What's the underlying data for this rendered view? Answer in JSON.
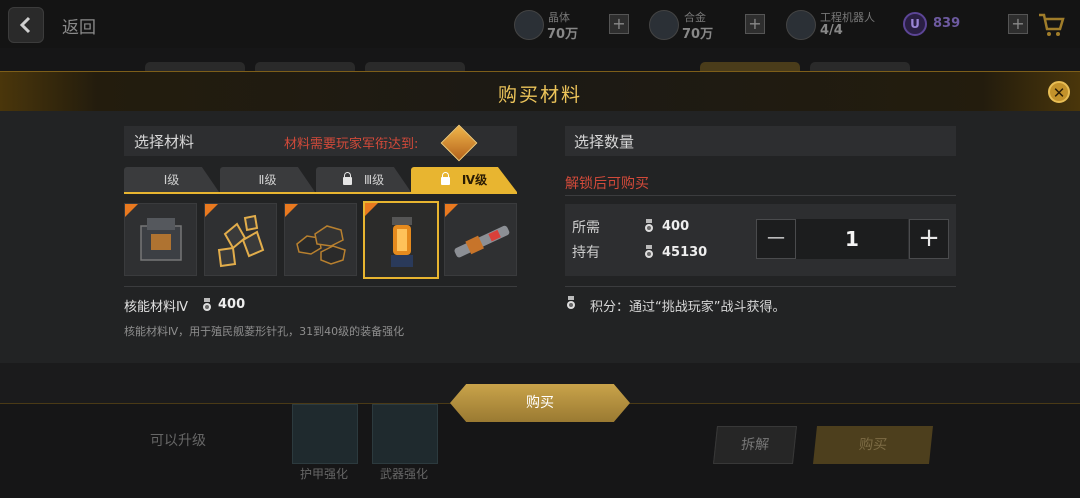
{
  "topbar": {
    "back_label": "返回",
    "resources": [
      {
        "name": "晶体",
        "value": "70万",
        "icon": "crystal-icon"
      },
      {
        "name": "合金",
        "value": "70万",
        "icon": "alloy-icon"
      },
      {
        "name": "工程机器人",
        "value": "4/4",
        "icon": "robot-icon"
      }
    ],
    "currency": {
      "symbol": "U",
      "value": "839"
    },
    "plus": "+"
  },
  "modal": {
    "title": "购买材料",
    "close_symbol": "✕",
    "left": {
      "section_label": "选择材料",
      "requirement_text": "材料需要玩家军衔达到:",
      "tiers": [
        {
          "label": "Ⅰ级",
          "locked": false,
          "active": false
        },
        {
          "label": "Ⅱ级",
          "locked": false,
          "active": false
        },
        {
          "label": "Ⅲ级",
          "locked": true,
          "active": false
        },
        {
          "label": "Ⅳ级",
          "locked": true,
          "active": true
        }
      ],
      "materials": [
        {
          "name": "armor-crate-material"
        },
        {
          "name": "crystal-cluster-material"
        },
        {
          "name": "hex-plate-material"
        },
        {
          "name": "energy-core-material",
          "selected": true
        },
        {
          "name": "rod-component-material"
        }
      ],
      "selected_name": "核能材料Ⅳ",
      "selected_cost": "400",
      "description": "核能材料Ⅳ，用于殖民舰菱形针孔，31到40级的装备强化"
    },
    "right": {
      "section_label": "选择数量",
      "unlock_text": "解锁后可购买",
      "required_label": "所需",
      "required_value": "400",
      "owned_label": "持有",
      "owned_value": "45130",
      "minus": "—",
      "plus": "+",
      "quantity": "1",
      "points_text": "积分：通过“挑战玩家”战斗获得。"
    },
    "buy_label": "购买"
  },
  "background": {
    "upgrade_label": "可以升级",
    "thumbs": [
      {
        "label": "护甲强化"
      },
      {
        "label": "武器强化"
      }
    ],
    "dismantle_label": "拆解",
    "buy_label": "购买"
  },
  "colors": {
    "accent_gold": "#e8b530",
    "warning_red": "#d24a3a",
    "orange_corner": "#e9791f"
  }
}
